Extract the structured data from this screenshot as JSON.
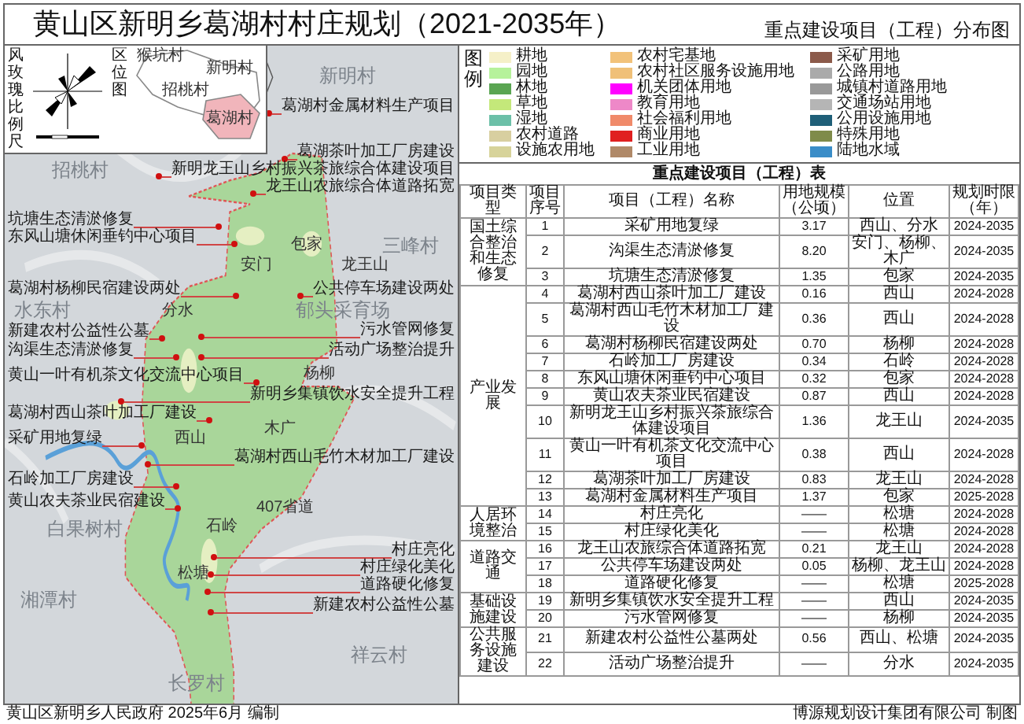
{
  "header": {
    "title": "黄山区新明乡葛湖村村庄规划（2021-2035年）",
    "subtitle": "重点建设项目（工程）分布图"
  },
  "inset": {
    "rose_label": "风玫瑰比例尺",
    "location_label": "区位图",
    "location_places": [
      "猴坑村",
      "新明村",
      "招桃村",
      "葛湖村"
    ]
  },
  "map": {
    "place_labels": [
      {
        "text": "新明村",
        "kind": "village"
      },
      {
        "text": "招桃村",
        "kind": "village"
      },
      {
        "text": "三峰村",
        "kind": "village"
      },
      {
        "text": "水东村",
        "kind": "village"
      },
      {
        "text": "郁头采育场",
        "kind": "village"
      },
      {
        "text": "祥云村",
        "kind": "village"
      },
      {
        "text": "白果树村",
        "kind": "village"
      },
      {
        "text": "湘潭村",
        "kind": "village"
      },
      {
        "text": "长罗村",
        "kind": "village"
      },
      {
        "text": "包家",
        "kind": "hamlet"
      },
      {
        "text": "安门",
        "kind": "hamlet"
      },
      {
        "text": "龙王山",
        "kind": "hamlet"
      },
      {
        "text": "分水",
        "kind": "hamlet"
      },
      {
        "text": "杨柳",
        "kind": "hamlet"
      },
      {
        "text": "西山",
        "kind": "hamlet"
      },
      {
        "text": "木广",
        "kind": "hamlet"
      },
      {
        "text": "石岭",
        "kind": "hamlet"
      },
      {
        "text": "407省道",
        "kind": "hamlet"
      },
      {
        "text": "松塘",
        "kind": "hamlet"
      }
    ],
    "callouts_left": [
      "坑塘生态清淤修复",
      "东风山塘休闲垂钓中心项目",
      "葛湖村杨柳民宿建设两处",
      "新建农村公益性公墓",
      "沟渠生态清淤修复",
      "黄山一叶有机茶文化交流中心项目",
      "葛湖村西山茶叶加工厂建设",
      "采矿用地复绿",
      "石岭加工厂房建设",
      "黄山农夫茶业民宿建设"
    ],
    "callouts_right": [
      "葛湖村金属材料生产项目",
      "葛湖茶叶加工厂房建设",
      "新明龙王山乡村振兴茶旅综合体建设项目",
      "龙王山农旅综合体道路拓宽",
      "公共停车场建设两处",
      "污水管网修复",
      "活动广场整治提升",
      "新明乡集镇饮水安全提升工程",
      "葛湖村西山毛竹木材加工厂建设",
      "村庄亮化",
      "村庄绿化美化",
      "道路硬化修复",
      "新建农村公益性公墓"
    ]
  },
  "legend": {
    "title": "图例",
    "items": [
      {
        "label": "耕地",
        "color": "#f5f0c8"
      },
      {
        "label": "园地",
        "color": "#b6f29b"
      },
      {
        "label": "林地",
        "color": "#5aa552"
      },
      {
        "label": "草地",
        "color": "#c4e87a"
      },
      {
        "label": "湿地",
        "color": "#6cc0a8"
      },
      {
        "label": "农村道路",
        "color": "#d8cfa0"
      },
      {
        "label": "设施农用地",
        "color": "#d7d39a"
      },
      {
        "label": "农村宅基地",
        "color": "#f2c27a"
      },
      {
        "label": "农村社区服务设施用地",
        "color": "#f0c078"
      },
      {
        "label": "机关团体用地",
        "color": "#ff00ff"
      },
      {
        "label": "教育用地",
        "color": "#ee88c8"
      },
      {
        "label": "社会福利用地",
        "color": "#f08a6a"
      },
      {
        "label": "商业用地",
        "color": "#e02020"
      },
      {
        "label": "工业用地",
        "color": "#b08968"
      },
      {
        "label": "采矿用地",
        "color": "#8b5a4a"
      },
      {
        "label": "公路用地",
        "color": "#aaaaaa"
      },
      {
        "label": "城镇村道路用地",
        "color": "#999999"
      },
      {
        "label": "交通场站用地",
        "color": "#b5b5b5"
      },
      {
        "label": "公用设施用地",
        "color": "#1f5f78"
      },
      {
        "label": "特殊用地",
        "color": "#7f8b4a"
      },
      {
        "label": "陆地水域",
        "color": "#3a8dc8"
      }
    ]
  },
  "table": {
    "title": "重点建设项目（工程）表",
    "columns": [
      "项目类型",
      "项目序号",
      "项目（工程）名称",
      "用地规模（公顷）",
      "位置",
      "规划时限（年）"
    ],
    "groups": [
      {
        "type": "国土综合整治和生态修复",
        "rows": [
          {
            "no": "1",
            "name": "采矿用地复绿",
            "area": "3.17",
            "location": "西山、分水",
            "period": "2024-2035"
          },
          {
            "no": "2",
            "name": "沟渠生态清淤修复",
            "area": "8.20",
            "location": "安门、杨柳、木广",
            "period": "2024-2035"
          },
          {
            "no": "3",
            "name": "坑塘生态清淤修复",
            "area": "1.35",
            "location": "包家",
            "period": "2024-2035"
          }
        ]
      },
      {
        "type": "产业发展",
        "rows": [
          {
            "no": "4",
            "name": "葛湖村西山茶叶加工厂建设",
            "area": "0.16",
            "location": "西山",
            "period": "2024-2028"
          },
          {
            "no": "5",
            "name": "葛湖村西山毛竹木材加工厂建设",
            "area": "0.36",
            "location": "西山",
            "period": "2024-2028"
          },
          {
            "no": "6",
            "name": "葛湖村杨柳民宿建设两处",
            "area": "0.70",
            "location": "杨柳",
            "period": "2024-2028"
          },
          {
            "no": "7",
            "name": "石岭加工厂房建设",
            "area": "0.34",
            "location": "石岭",
            "period": "2024-2028"
          },
          {
            "no": "8",
            "name": "东风山塘休闲垂钓中心项目",
            "area": "0.32",
            "location": "包家",
            "period": "2024-2028"
          },
          {
            "no": "9",
            "name": "黄山农夫茶业民宿建设",
            "area": "0.87",
            "location": "西山",
            "period": "2024-2028"
          },
          {
            "no": "10",
            "name": "新明龙王山乡村振兴茶旅综合体建设项目",
            "area": "1.36",
            "location": "龙王山",
            "period": "2024-2035"
          },
          {
            "no": "11",
            "name": "黄山一叶有机茶文化交流中心项目",
            "area": "0.38",
            "location": "西山",
            "period": "2024-2028"
          },
          {
            "no": "12",
            "name": "葛湖茶叶加工厂房建设",
            "area": "0.83",
            "location": "龙王山",
            "period": "2024-2028"
          },
          {
            "no": "13",
            "name": "葛湖村金属材料生产项目",
            "area": "1.37",
            "location": "包家",
            "period": "2025-2028"
          }
        ]
      },
      {
        "type": "人居环境整治",
        "rows": [
          {
            "no": "14",
            "name": "村庄亮化",
            "area": "——",
            "location": "松塘",
            "period": "2024-2028"
          },
          {
            "no": "15",
            "name": "村庄绿化美化",
            "area": "——",
            "location": "松塘",
            "period": "2024-2028"
          }
        ]
      },
      {
        "type": "道路交通",
        "rows": [
          {
            "no": "16",
            "name": "龙王山农旅综合体道路拓宽",
            "area": "0.21",
            "location": "龙王山",
            "period": "2024-2028"
          },
          {
            "no": "17",
            "name": "公共停车场建设两处",
            "area": "0.05",
            "location": "杨柳、龙王山",
            "period": "2024-2028"
          },
          {
            "no": "18",
            "name": "道路硬化修复",
            "area": "——",
            "location": "松塘",
            "period": "2025-2028"
          }
        ]
      },
      {
        "type": "基础设施建设",
        "rows": [
          {
            "no": "19",
            "name": "新明乡集镇饮水安全提升工程",
            "area": "——",
            "location": "西山",
            "period": "2024-2035"
          },
          {
            "no": "20",
            "name": "污水管网修复",
            "area": "——",
            "location": "杨柳",
            "period": "2024-2035"
          }
        ]
      },
      {
        "type": "公共服务设施建设",
        "rows": [
          {
            "no": "21",
            "name": "新建农村公益性公墓两处",
            "area": "0.56",
            "location": "西山、松塘",
            "period": "2024-2035"
          },
          {
            "no": "22",
            "name": "活动广场整治提升",
            "area": "——",
            "location": "分水",
            "period": "2024-2035"
          }
        ]
      }
    ]
  },
  "footer": {
    "left": "黄山区新明乡人民政府 2025年6月 编制",
    "right": "博源规划设计集团有限公司 制图"
  }
}
